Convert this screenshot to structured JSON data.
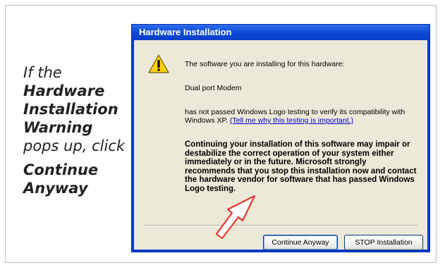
{
  "caption": {
    "line1": "If the",
    "line2": "Hardware",
    "line3": "Installation",
    "line4": "Warning",
    "line5": "pops up, click",
    "line6": "Continue",
    "line7": "Anyway"
  },
  "dialog": {
    "title": "Hardware Installation",
    "icon": "warning-icon",
    "intro": "The software you are installing for this hardware:",
    "device": "Dual port Modem",
    "not_passed": "has not passed Windows Logo testing to verify its compatibility with Windows XP. ",
    "link": "(Tell me why this testing is important.)",
    "warning_text": "Continuing your installation of this software may impair or destabilize the correct operation of your system either immediately or in the future. Microsoft strongly recommends that you stop this installation now and contact the hardware vendor for software that has passed Windows Logo testing.",
    "continue_label": "Continue Anyway",
    "stop_label": "STOP Installation"
  },
  "colors": {
    "titlebar": "#0a46d6",
    "dialog_bg": "#ece9d8",
    "arrow": "#e8392d"
  }
}
